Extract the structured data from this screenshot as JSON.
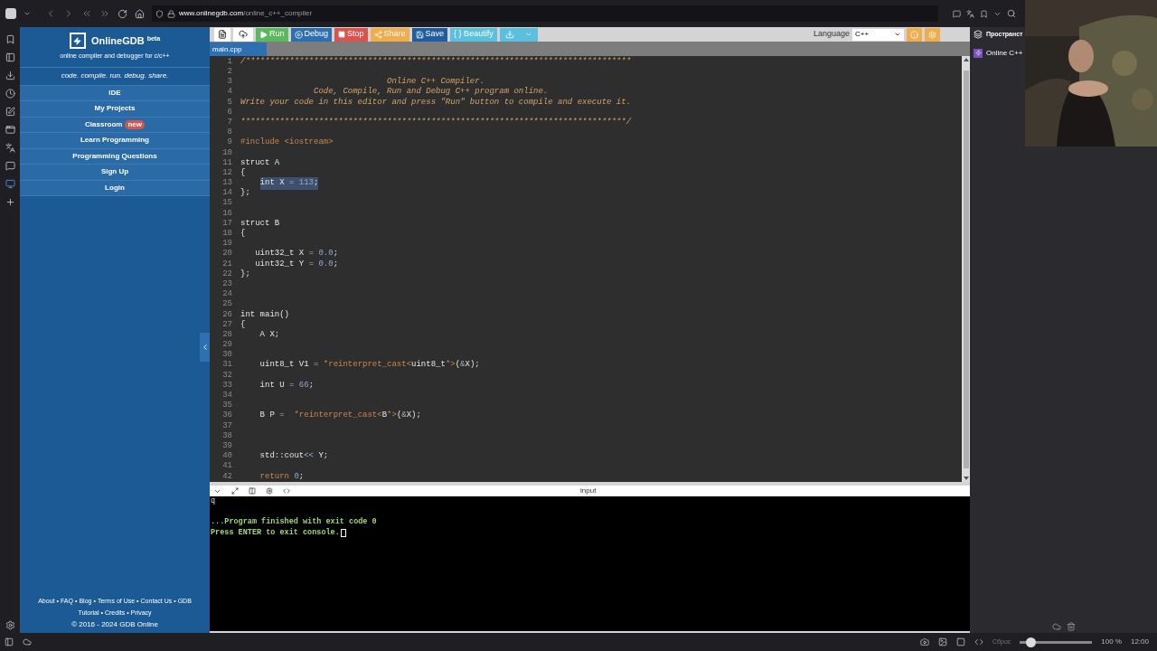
{
  "browser": {
    "url_host": "www.onlinegdb.com",
    "url_path": "/online_c++_compiler",
    "panel_title": "Пространст",
    "panel_tab": "Online C++",
    "status": {
      "reset": "Сброс",
      "zoom": "100 %",
      "time": "12:00",
      "zoom_level": {
        "level": 0.15
      }
    }
  },
  "sidebar": {
    "brand": "OnlineGDB",
    "brand_sup": "beta",
    "subtitle": "online compiler and debugger for c/c++",
    "tagline": "code. compile. run. debug. share.",
    "menu": [
      {
        "label": "IDE"
      },
      {
        "label": "My Projects"
      },
      {
        "label": "Classroom",
        "badge": "new"
      },
      {
        "label": "Learn Programming"
      },
      {
        "label": "Programming Questions"
      },
      {
        "label": "Sign Up"
      },
      {
        "label": "Login"
      }
    ],
    "footer_separator": "•",
    "footer_links": [
      [
        "About",
        "FAQ",
        "Blog",
        "Terms of Use",
        "Contact Us",
        "GDB"
      ],
      [
        "Tutorial",
        "Credits",
        "Privacy"
      ]
    ],
    "copyright": "© 2016 - 2024 GDB Online"
  },
  "toolbar": {
    "buttons": [
      {
        "kind": "file"
      },
      {
        "kind": "upload"
      },
      {
        "kind": "run",
        "label": "Run"
      },
      {
        "kind": "debug",
        "label": "Debug"
      },
      {
        "kind": "stop",
        "label": "Stop"
      },
      {
        "kind": "share",
        "label": "Share"
      },
      {
        "kind": "save",
        "label": "Save"
      },
      {
        "kind": "beautify",
        "label": "{ } Beautify"
      },
      {
        "kind": "download"
      }
    ],
    "language_label": "Language",
    "language": "C++"
  },
  "tabs": [
    {
      "label": "main.cpp",
      "selected": true
    }
  ],
  "editor": {
    "lines": [
      {
        "num": "1",
        "selected": false,
        "segments": [
          {
            "kind": "comment",
            "text": "/*******************************************************************************"
          }
        ]
      },
      {
        "num": "2",
        "selected": false
      },
      {
        "num": "3",
        "selected": false,
        "segments": [
          {
            "kind": "comment",
            "text": "                              Online C++ Compiler."
          }
        ]
      },
      {
        "num": "4",
        "selected": false,
        "segments": [
          {
            "kind": "comment",
            "text": "               Code, Compile, Run and Debug C++ program online."
          }
        ]
      },
      {
        "num": "5",
        "selected": false,
        "segments": [
          {
            "kind": "comment",
            "text": "Write your code in this editor and press \"Run\" button to compile and execute it."
          }
        ]
      },
      {
        "num": "6",
        "selected": false
      },
      {
        "num": "7",
        "selected": false,
        "segments": [
          {
            "kind": "comment",
            "text": "*******************************************************************************/"
          }
        ]
      },
      {
        "num": "8",
        "selected": false
      },
      {
        "num": "9",
        "selected": false,
        "segments": [
          {
            "kind": "preproc",
            "text": "#include <iostream>"
          }
        ]
      },
      {
        "num": "10",
        "selected": false
      },
      {
        "num": "11",
        "selected": false,
        "segments": [
          {
            "kind": "plain",
            "text": "struct A"
          }
        ]
      },
      {
        "num": "12",
        "selected": false,
        "segments": [
          {
            "kind": "plain",
            "text": "{"
          }
        ]
      },
      {
        "num": "13",
        "selected": true,
        "segments": [
          {
            "kind": "plain",
            "text": "    int X "
          },
          {
            "kind": "op",
            "text": "="
          },
          {
            "kind": "number",
            "text": " 113"
          },
          {
            "kind": "plain",
            "text": ";"
          }
        ]
      },
      {
        "num": "14",
        "selected": false,
        "segments": [
          {
            "kind": "plain",
            "text": "};"
          }
        ]
      },
      {
        "num": "15",
        "selected": false
      },
      {
        "num": "16",
        "selected": false
      },
      {
        "num": "17",
        "selected": false,
        "segments": [
          {
            "kind": "plain",
            "text": "struct B"
          }
        ]
      },
      {
        "num": "18",
        "selected": false,
        "segments": [
          {
            "kind": "plain",
            "text": "{"
          }
        ]
      },
      {
        "num": "19",
        "selected": false
      },
      {
        "num": "20",
        "selected": false,
        "segments": [
          {
            "kind": "plain",
            "text": "   uint32_t X "
          },
          {
            "kind": "op",
            "text": "="
          },
          {
            "kind": "number",
            "text": " 0.0"
          },
          {
            "kind": "plain",
            "text": ";"
          }
        ]
      },
      {
        "num": "21",
        "selected": false,
        "segments": [
          {
            "kind": "plain",
            "text": "   uint32_t Y "
          },
          {
            "kind": "op",
            "text": "="
          },
          {
            "kind": "number",
            "text": " 0.0"
          },
          {
            "kind": "plain",
            "text": ";"
          }
        ]
      },
      {
        "num": "22",
        "selected": false,
        "segments": [
          {
            "kind": "plain",
            "text": "};"
          }
        ]
      },
      {
        "num": "23",
        "selected": false
      },
      {
        "num": "24",
        "selected": false
      },
      {
        "num": "25",
        "selected": false
      },
      {
        "num": "26",
        "selected": false,
        "segments": [
          {
            "kind": "plain",
            "text": "int main()"
          }
        ]
      },
      {
        "num": "27",
        "selected": false,
        "segments": [
          {
            "kind": "plain",
            "text": "{"
          }
        ]
      },
      {
        "num": "28",
        "selected": false,
        "segments": [
          {
            "kind": "plain",
            "text": "    A X;"
          }
        ]
      },
      {
        "num": "29",
        "selected": false
      },
      {
        "num": "30",
        "selected": false
      },
      {
        "num": "31",
        "selected": false,
        "segments": [
          {
            "kind": "plain",
            "text": "    uint8_t V1 "
          },
          {
            "kind": "op",
            "text": "="
          },
          {
            "kind": "cast",
            "text": " *reinterpret_cast<"
          },
          {
            "kind": "plain",
            "text": "uint8_t"
          },
          {
            "kind": "cast",
            "text": "*>"
          },
          {
            "kind": "plain",
            "text": "("
          },
          {
            "kind": "op",
            "text": "&"
          },
          {
            "kind": "plain",
            "text": "X);"
          }
        ]
      },
      {
        "num": "32",
        "selected": false
      },
      {
        "num": "33",
        "selected": false,
        "segments": [
          {
            "kind": "plain",
            "text": "    int U "
          },
          {
            "kind": "op",
            "text": "="
          },
          {
            "kind": "number",
            "text": " 66"
          },
          {
            "kind": "plain",
            "text": ";"
          }
        ]
      },
      {
        "num": "34",
        "selected": false
      },
      {
        "num": "35",
        "selected": false
      },
      {
        "num": "36",
        "selected": false,
        "segments": [
          {
            "kind": "plain",
            "text": "    B P "
          },
          {
            "kind": "op",
            "text": "="
          },
          {
            "kind": "cast",
            "text": "  *reinterpret_cast<"
          },
          {
            "kind": "plain",
            "text": "B"
          },
          {
            "kind": "cast",
            "text": "*>"
          },
          {
            "kind": "plain",
            "text": "("
          },
          {
            "kind": "op",
            "text": "&"
          },
          {
            "kind": "plain",
            "text": "X);"
          }
        ]
      },
      {
        "num": "37",
        "selected": false
      },
      {
        "num": "38",
        "selected": false
      },
      {
        "num": "39",
        "selected": false
      },
      {
        "num": "40",
        "selected": false,
        "segments": [
          {
            "kind": "plain",
            "text": "    std::cout"
          },
          {
            "kind": "op",
            "text": "<<"
          },
          {
            "kind": "plain",
            "text": " Y;"
          }
        ]
      },
      {
        "num": "41",
        "selected": false
      },
      {
        "num": "42",
        "selected": false,
        "segments": [
          {
            "kind": "cast",
            "text": "    return"
          },
          {
            "kind": "number",
            "text": " 0"
          },
          {
            "kind": "plain",
            "text": ";"
          }
        ]
      }
    ]
  },
  "console": {
    "input_label": "input",
    "lines": [
      {
        "kind": "input",
        "text": "q"
      },
      {
        "kind": "output",
        "text": "...Program finished with exit code 0"
      },
      {
        "kind": "prompt",
        "text": "Press ENTER to exit console."
      }
    ]
  }
}
